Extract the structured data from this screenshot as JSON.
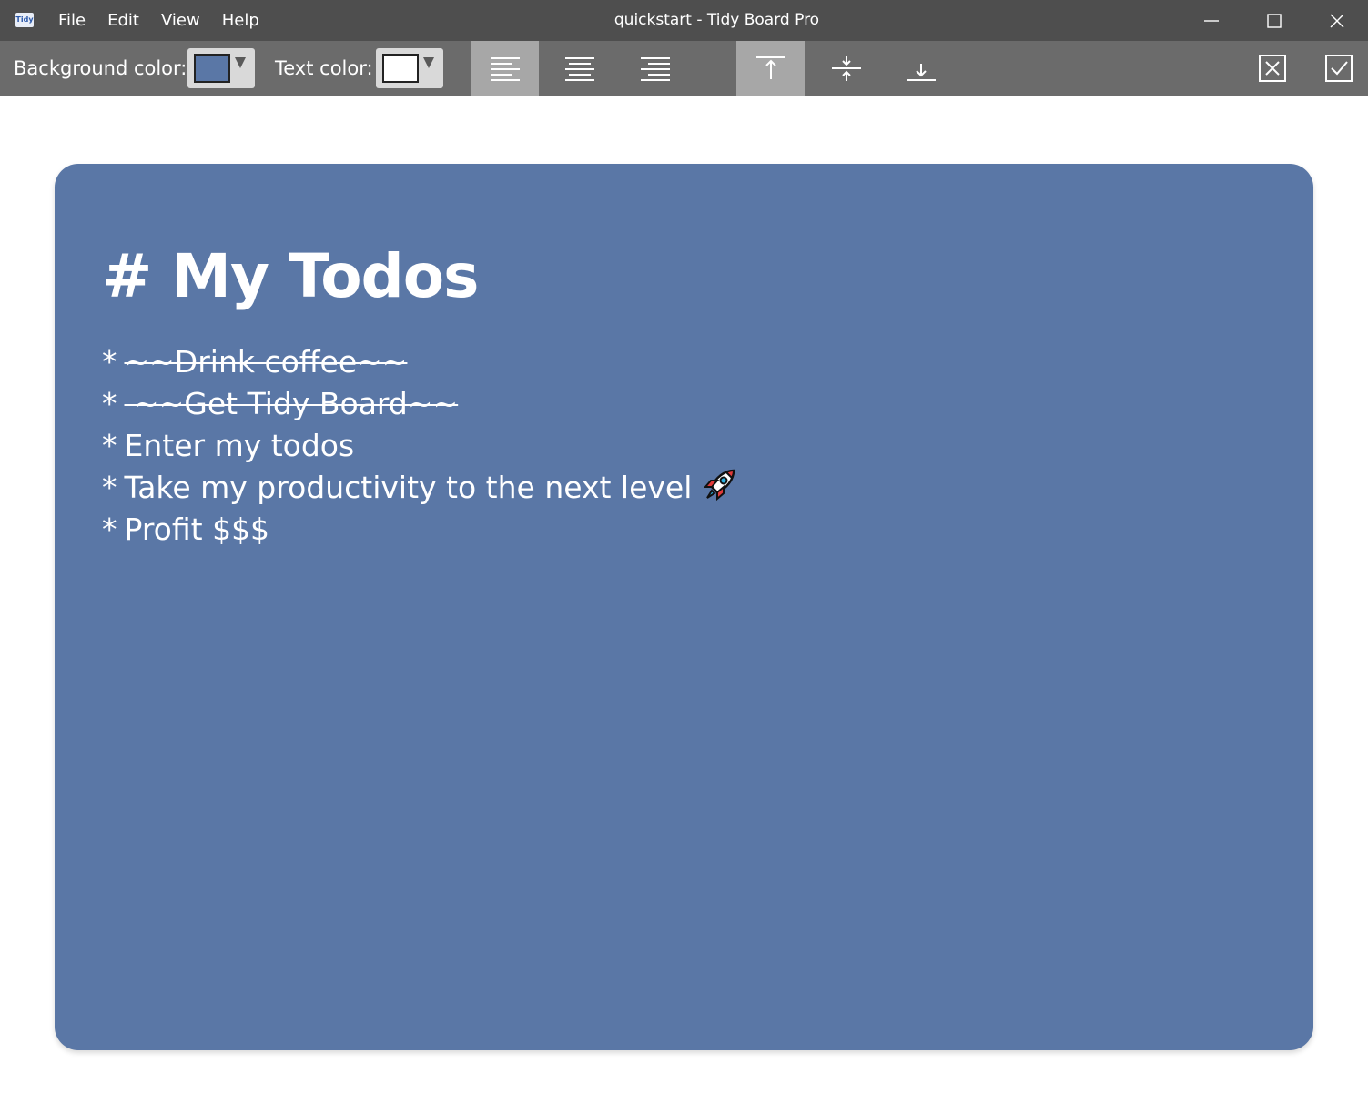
{
  "window": {
    "app_icon_text": "Tidy",
    "title": "quickstart - Tidy Board Pro",
    "menu": [
      "File",
      "Edit",
      "View",
      "Help"
    ]
  },
  "toolbar": {
    "background_color_label": "Background color:",
    "text_color_label": "Text color:",
    "background_color_value": "#5a77a6",
    "text_color_value": "#ffffff",
    "horizontal_alignment": "left",
    "vertical_alignment": "top"
  },
  "board": {
    "background": "#5a77a6",
    "text_color": "#ffffff",
    "heading": "# My Todos",
    "items": [
      {
        "bullet": "*",
        "text": "~~Drink coffee~~"
      },
      {
        "bullet": "*",
        "text": " ~~Get Tidy Board~~"
      },
      {
        "bullet": "*",
        "text": "Enter my todos"
      },
      {
        "bullet": "*",
        "text": "Take my productivity to the next level"
      },
      {
        "bullet": "*",
        "text": "Profit $$$"
      }
    ]
  },
  "icons": {
    "rocket": "rocket-icon"
  }
}
